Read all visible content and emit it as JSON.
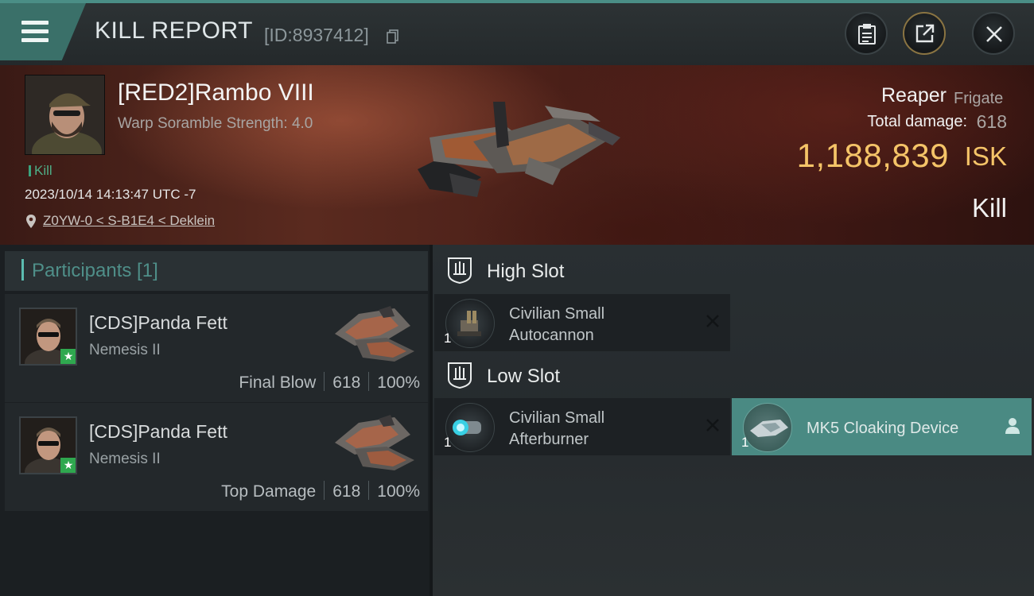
{
  "header": {
    "title": "KILL REPORT",
    "report_id": "[ID:8937412]"
  },
  "victim": {
    "name": "[RED2]Rambo VIII",
    "scramble": "Warp Soramble Strength: 4.0",
    "tag": "Kill",
    "datetime": "2023/10/14 14:13:47 UTC -7",
    "location": "Z0YW-0 < S-B1E4 < Deklein",
    "ship_name": "Reaper",
    "ship_class": "Frigate",
    "total_damage_label": "Total damage:",
    "total_damage": "618",
    "isk_value": "1,188,839",
    "isk_unit": "ISK",
    "result": "Kill"
  },
  "participants": {
    "title": "Participants [1]",
    "items": [
      {
        "name": "[CDS]Panda Fett",
        "ship": "Nemesis II",
        "role": "Final Blow",
        "damage": "618",
        "percent": "100%"
      },
      {
        "name": "[CDS]Panda Fett",
        "ship": "Nemesis II",
        "role": "Top Damage",
        "damage": "618",
        "percent": "100%"
      }
    ]
  },
  "fitting": {
    "high_slot": {
      "title": "High Slot",
      "modules": [
        {
          "name_line1": "Civilian Small",
          "name_line2": "Autocannon",
          "qty": "1"
        }
      ]
    },
    "low_slot": {
      "title": "Low Slot",
      "modules": [
        {
          "name_line1": "Civilian Small",
          "name_line2": "Afterburner",
          "qty": "1"
        },
        {
          "name_line1": "MK5 Cloaking Device",
          "qty": "1"
        }
      ]
    }
  },
  "colors": {
    "accent": "#4a8a83",
    "isk": "#f5c468",
    "kill_tag": "#4fae86",
    "participants_title": "#4f8f89",
    "star": "#2fa84f"
  }
}
